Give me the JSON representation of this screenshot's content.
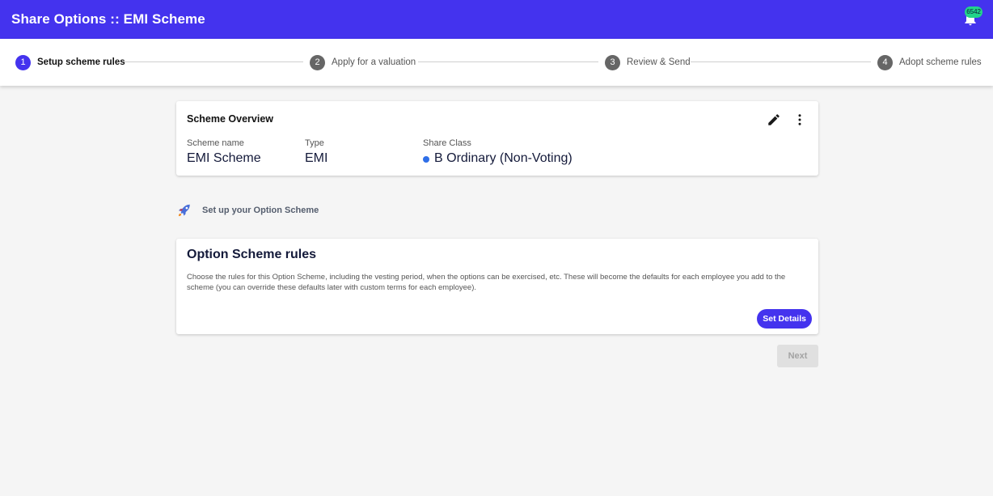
{
  "header": {
    "title": "Share Options :: EMI Scheme",
    "notification_count": "6542",
    "accent_color": "#4433ee",
    "badge_color": "#22d48a"
  },
  "stepper": {
    "steps": [
      {
        "number": "1",
        "label": "Setup scheme rules",
        "active": true
      },
      {
        "number": "2",
        "label": "Apply for a valuation",
        "active": false
      },
      {
        "number": "3",
        "label": "Review & Send",
        "active": false
      },
      {
        "number": "4",
        "label": "Adopt scheme rules",
        "active": false
      }
    ]
  },
  "overview": {
    "title": "Scheme Overview",
    "fields": [
      {
        "label": "Scheme name",
        "value": "EMI Scheme"
      },
      {
        "label": "Type",
        "value": "EMI"
      },
      {
        "label": "Share Class",
        "value": "B Ordinary (Non-Voting)",
        "dot_color": "#2f6fe8"
      }
    ],
    "icons": [
      "edit-icon",
      "more-vertical-icon"
    ]
  },
  "setup": {
    "icon": "rocket-icon",
    "text": "Set up your Option Scheme"
  },
  "rules": {
    "title": "Option Scheme rules",
    "description": "Choose the rules for this Option Scheme, including the vesting period, when the options can be exercised, etc. These will become the defaults for each employee you add to the scheme (you can override these defaults later with custom terms for each employee).",
    "button_label": "Set Details"
  },
  "footer": {
    "next_label": "Next",
    "next_disabled": true
  }
}
